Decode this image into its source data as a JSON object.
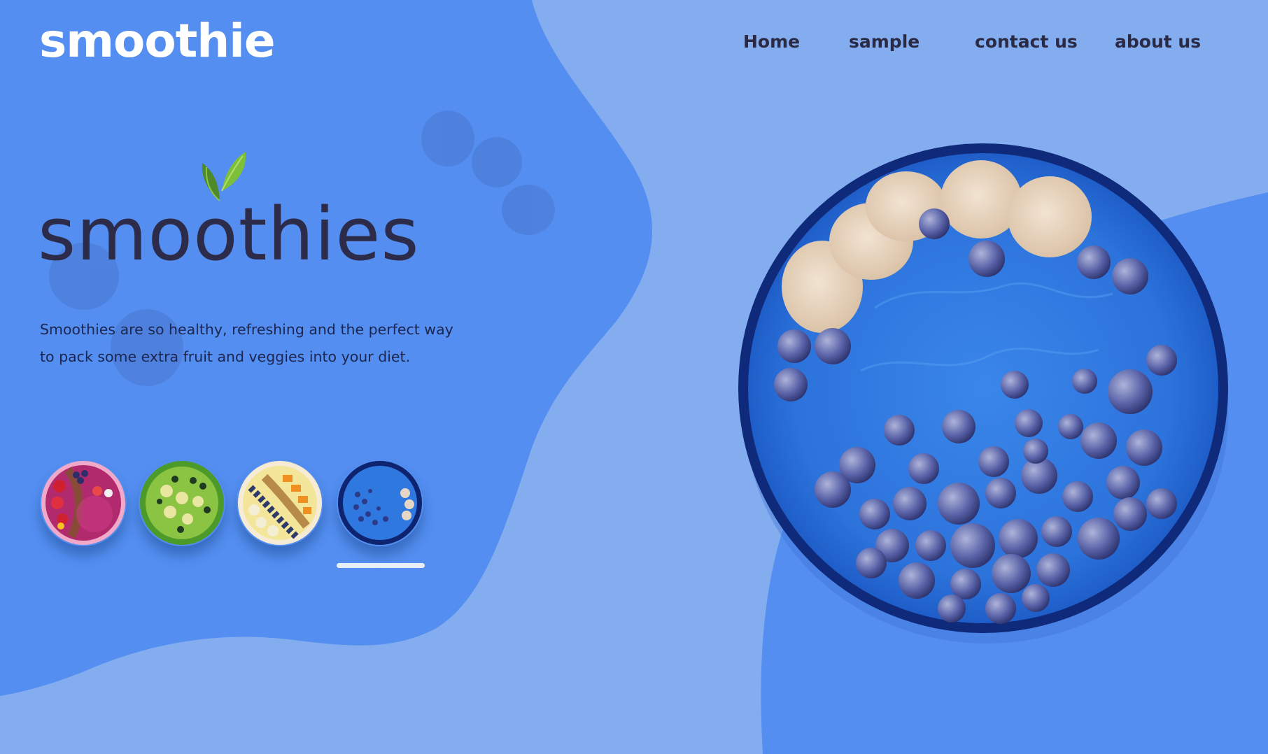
{
  "brand": {
    "logo": "smoothie"
  },
  "nav": {
    "items": [
      "Home",
      "sample",
      "contact us",
      "about us"
    ]
  },
  "hero": {
    "headline": "smoothies",
    "description_line1": "Smoothies are so healthy, refreshing and the perfect way",
    "description_line2": "to pack some extra fruit and veggies into your diet."
  },
  "carousel": {
    "items": [
      "berry-bowl",
      "kiwi-bowl",
      "mango-bowl",
      "blueberry-bowl"
    ],
    "active_index": 3
  },
  "colors": {
    "page_background": "#84adf0",
    "blob": "#538ef0",
    "headline_text": "#2d2b4a",
    "logo_text": "#ffffff",
    "nav_text": "#2b2a45",
    "bowl_blue": "#2f78e0",
    "bowl_rim": "#0e2470"
  }
}
